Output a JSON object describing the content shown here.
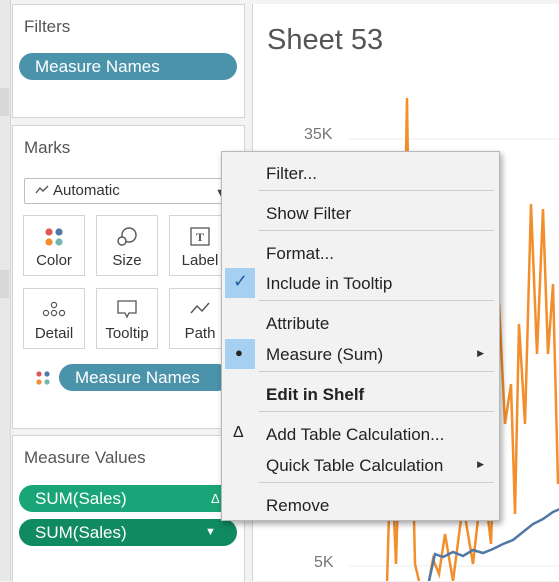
{
  "filters": {
    "title": "Filters",
    "pill": "Measure Names"
  },
  "marks": {
    "title": "Marks",
    "mark_type": "Automatic",
    "buttons": {
      "color": "Color",
      "size": "Size",
      "label": "Label",
      "detail": "Detail",
      "tooltip": "Tooltip",
      "path": "Path"
    },
    "pill": "Measure Names"
  },
  "measure_values": {
    "title": "Measure Values",
    "items": [
      "SUM(Sales)",
      "SUM(Sales)"
    ],
    "delta_symbol": "Δ"
  },
  "sheet": {
    "title": "Sheet 53",
    "ticks": [
      "35K",
      "5K"
    ],
    "series_colors": {
      "orange": "#f28e2b",
      "blue": "#4e79a7"
    }
  },
  "context_menu": {
    "filter": "Filter...",
    "show_filter": "Show Filter",
    "format": "Format...",
    "include_tooltip": "Include in Tooltip",
    "attribute": "Attribute",
    "measure_sum": "Measure (Sum)",
    "edit_in_shelf": "Edit in Shelf",
    "add_table_calc": "Add Table Calculation...",
    "quick_table_calc": "Quick Table Calculation",
    "remove": "Remove",
    "delta_symbol": "Δ",
    "check_symbol": "✓",
    "bullet_symbol": "●",
    "submenu_symbol": "▶",
    "highlight_color": "#a5d0f2"
  }
}
